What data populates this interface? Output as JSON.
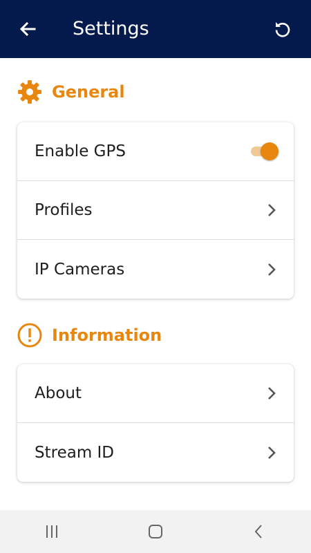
{
  "appbar": {
    "title": "Settings",
    "back_icon": "arrow-left-icon",
    "refresh_icon": "refresh-icon",
    "background": "#041a4c"
  },
  "sections": {
    "general": {
      "title": "General",
      "icon": "gear-icon",
      "items": {
        "enable_gps": {
          "label": "Enable GPS",
          "toggle_on": true
        },
        "profiles": {
          "label": "Profiles"
        },
        "ip_cameras": {
          "label": "IP Cameras"
        }
      }
    },
    "information": {
      "title": "Information",
      "icon": "alert-circle-icon",
      "items": {
        "about": {
          "label": "About"
        },
        "stream_id": {
          "label": "Stream ID"
        }
      }
    }
  },
  "accent_color": "#e8870f",
  "system_nav": {
    "recent_icon": "recent-apps-icon",
    "home_icon": "home-icon",
    "back_icon": "back-chevron-icon"
  }
}
